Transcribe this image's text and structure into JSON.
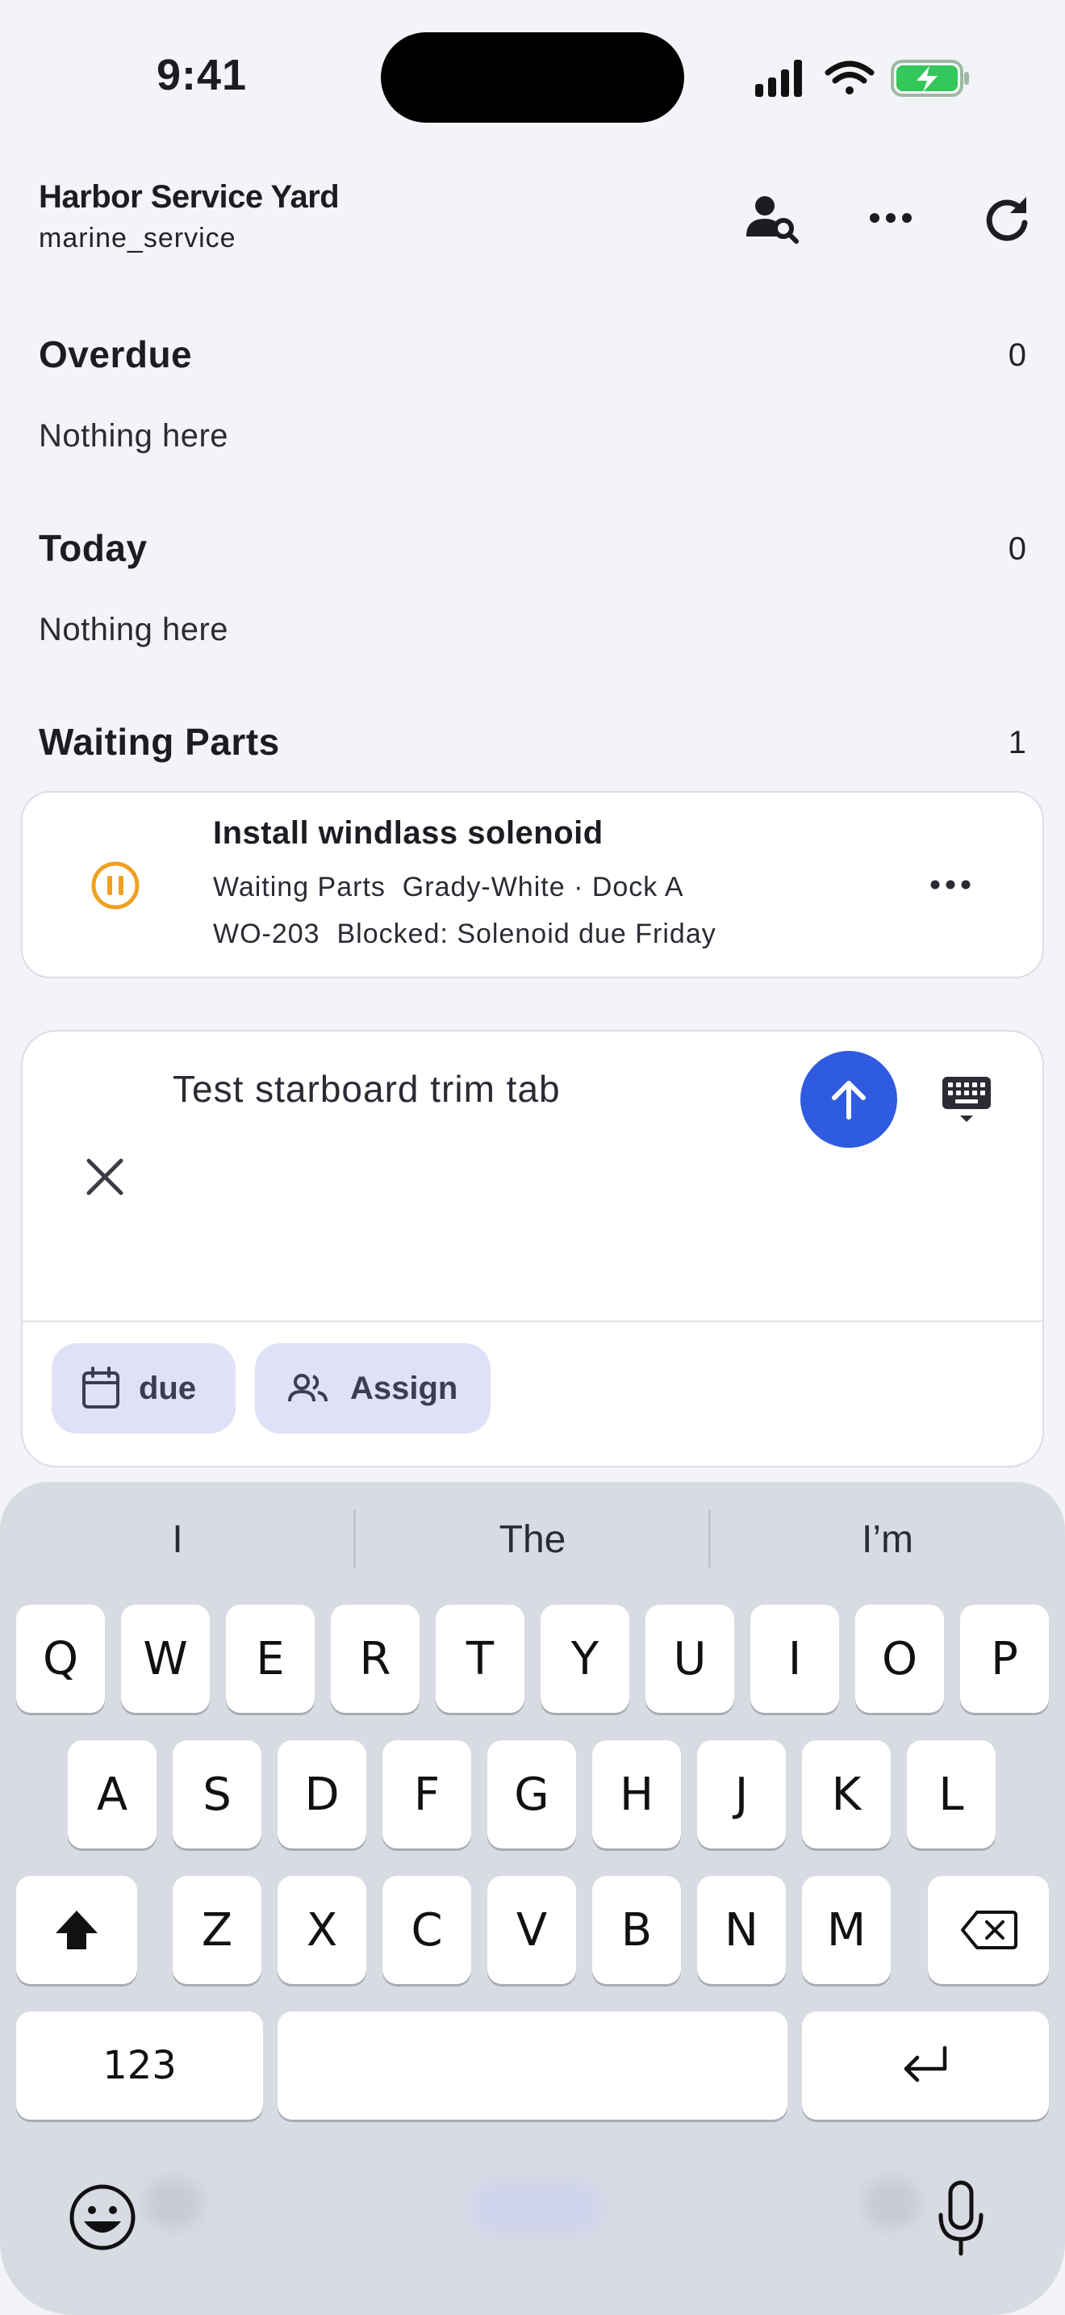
{
  "status": {
    "time": "9:41"
  },
  "header": {
    "title": "Harbor Service Yard",
    "subtitle": "marine_service"
  },
  "sections": {
    "overdue": {
      "title": "Overdue",
      "count": "0",
      "empty": "Nothing here"
    },
    "today": {
      "title": "Today",
      "count": "0",
      "empty": "Nothing here"
    },
    "waiting": {
      "title": "Waiting Parts",
      "count": "1"
    }
  },
  "card": {
    "title": "Install windlass solenoid",
    "line1": "Waiting Parts  Grady-White · Dock A",
    "line2": "WO-203  Blocked: Solenoid due Friday"
  },
  "composer": {
    "text": "Test starboard trim tab",
    "chip_due": "due",
    "chip_assign": "Assign"
  },
  "keyboard": {
    "suggestions": [
      "I",
      "The",
      "I’m"
    ],
    "row1": [
      "Q",
      "W",
      "E",
      "R",
      "T",
      "Y",
      "U",
      "I",
      "O",
      "P"
    ],
    "row2": [
      "A",
      "S",
      "D",
      "F",
      "G",
      "H",
      "J",
      "K",
      "L"
    ],
    "row3": [
      "Z",
      "X",
      "C",
      "V",
      "B",
      "N",
      "M"
    ],
    "numbers_label": "123"
  },
  "colors": {
    "accent": "#2f5be0",
    "chip_bg": "#e0e1f7",
    "pause": "#f0a020"
  }
}
